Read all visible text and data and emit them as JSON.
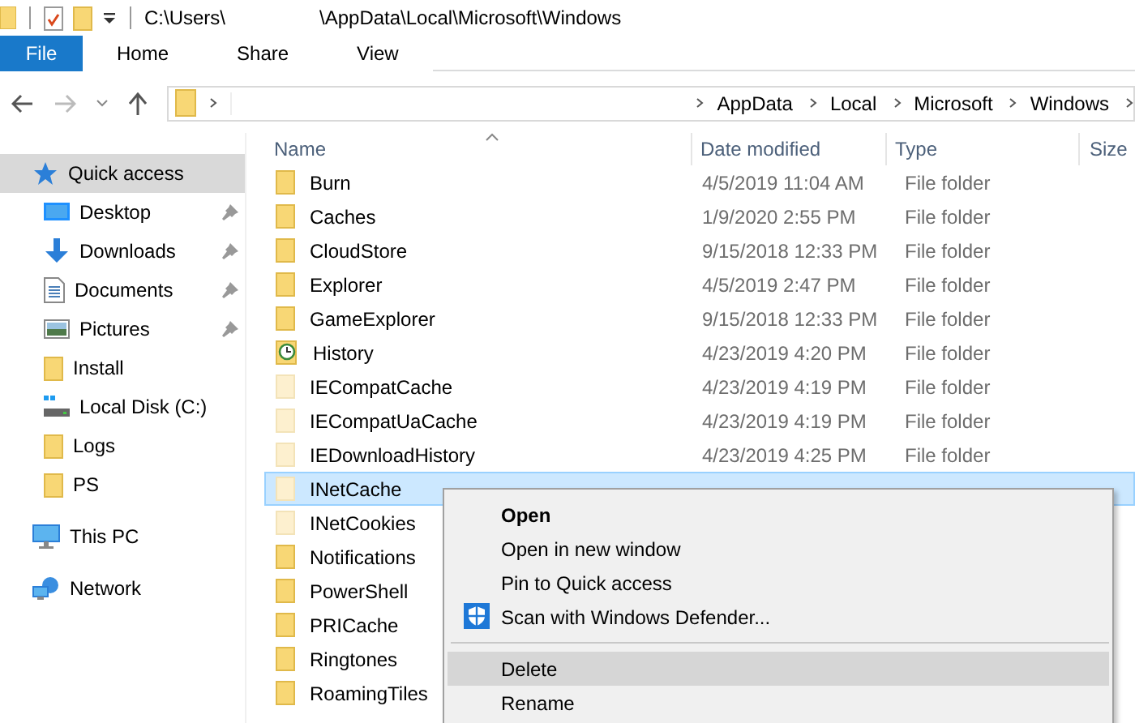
{
  "title_bar": {
    "path_start": "C:\\Users\\",
    "path_end": "\\AppData\\Local\\Microsoft\\Windows"
  },
  "ribbon_tabs": [
    {
      "label": "File",
      "kind": "file"
    },
    {
      "label": "Home",
      "kind": "tab"
    },
    {
      "label": "Share",
      "kind": "tab"
    },
    {
      "label": "View",
      "kind": "tab"
    }
  ],
  "address_bar": {
    "segments": [
      "AppData",
      "Local",
      "Microsoft",
      "Windows"
    ]
  },
  "sidebar": {
    "items": [
      {
        "label": "Quick access",
        "kind": "star",
        "selected": true,
        "children": [
          {
            "label": "Desktop",
            "kind": "desktop",
            "pinned": true,
            "selected": false
          },
          {
            "label": "Downloads",
            "kind": "download",
            "pinned": true,
            "selected": false
          },
          {
            "label": "Documents",
            "kind": "document",
            "pinned": true,
            "selected": false
          },
          {
            "label": "Pictures",
            "kind": "pictures",
            "pinned": true,
            "selected": false
          },
          {
            "label": "Install",
            "kind": "folder",
            "pinned": false,
            "selected": false
          },
          {
            "label": "Local Disk (C:)",
            "kind": "disk",
            "pinned": false,
            "selected": false
          },
          {
            "label": "Logs",
            "kind": "folder",
            "pinned": false,
            "selected": false
          },
          {
            "label": "PS",
            "kind": "folder",
            "pinned": false,
            "selected": false
          }
        ]
      },
      {
        "label": "This PC",
        "kind": "pc",
        "selected": false
      },
      {
        "label": "Network",
        "kind": "network",
        "selected": false
      }
    ]
  },
  "table": {
    "columns": [
      "Name",
      "Date modified",
      "Type",
      "Size"
    ],
    "rows": [
      {
        "name": "Burn",
        "date": "4/5/2019 11:04 AM",
        "type": "File folder",
        "kind": "folder",
        "selected": false
      },
      {
        "name": "Caches",
        "date": "1/9/2020 2:55 PM",
        "type": "File folder",
        "kind": "folder",
        "selected": false
      },
      {
        "name": "CloudStore",
        "date": "9/15/2018 12:33 PM",
        "type": "File folder",
        "kind": "folder",
        "selected": false
      },
      {
        "name": "Explorer",
        "date": "4/5/2019 2:47 PM",
        "type": "File folder",
        "kind": "folder",
        "selected": false
      },
      {
        "name": "GameExplorer",
        "date": "9/15/2018 12:33 PM",
        "type": "File folder",
        "kind": "folder",
        "selected": false
      },
      {
        "name": "History",
        "date": "4/23/2019 4:20 PM",
        "type": "File folder",
        "kind": "history",
        "selected": false
      },
      {
        "name": "IECompatCache",
        "date": "4/23/2019 4:19 PM",
        "type": "File folder",
        "kind": "hidden",
        "selected": false
      },
      {
        "name": "IECompatUaCache",
        "date": "4/23/2019 4:19 PM",
        "type": "File folder",
        "kind": "hidden",
        "selected": false
      },
      {
        "name": "IEDownloadHistory",
        "date": "4/23/2019 4:25 PM",
        "type": "File folder",
        "kind": "hidden",
        "selected": false
      },
      {
        "name": "INetCache",
        "kind": "hidden",
        "selected": true
      },
      {
        "name": "INetCookies",
        "kind": "hidden",
        "selected": false
      },
      {
        "name": "Notifications",
        "kind": "folder",
        "selected": false
      },
      {
        "name": "PowerShell",
        "kind": "folder",
        "selected": false
      },
      {
        "name": "PRICache",
        "kind": "folder",
        "selected": false
      },
      {
        "name": "Ringtones",
        "kind": "folder",
        "selected": false
      },
      {
        "name": "RoamingTiles",
        "kind": "folder",
        "selected": false
      }
    ]
  },
  "context_menu": {
    "items": [
      {
        "kind": "item",
        "label": "Open",
        "bold": true,
        "highlighted": false
      },
      {
        "kind": "item",
        "label": "Open in new window",
        "bold": false,
        "highlighted": false
      },
      {
        "kind": "item",
        "label": "Pin to Quick access",
        "bold": false,
        "highlighted": false
      },
      {
        "kind": "scan",
        "label": "Scan with Windows Defender...",
        "bold": false,
        "highlighted": false
      },
      {
        "kind": "separator"
      },
      {
        "kind": "item",
        "label": "Delete",
        "bold": false,
        "highlighted": true
      },
      {
        "kind": "item",
        "label": "Rename",
        "bold": false,
        "highlighted": false
      }
    ]
  }
}
